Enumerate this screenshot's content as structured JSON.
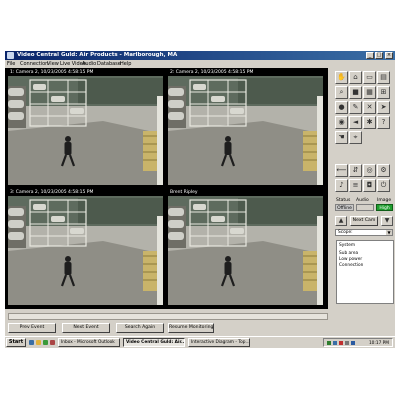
{
  "window": {
    "title": "Video Central Guld: Air Products - Marlborough, MA"
  },
  "menu": [
    "File",
    "Connection",
    "View",
    "Live Video",
    "Audio",
    "Database",
    "Help"
  ],
  "cameras": [
    {
      "label": "1: Camera 2, 10/23/2005 4:58:15 PM"
    },
    {
      "label": "2: Camera 2, 10/23/2005 4:58:15 PM"
    },
    {
      "label": "3: Camera 2, 10/23/2005 4:58:15 PM"
    },
    {
      "label": "Brent Ripley"
    }
  ],
  "status_panel": {
    "status_label": "Status",
    "audio_label": "Audio",
    "image_label": "Image",
    "status_value": "Offline",
    "image_value": "High",
    "next_cam": "Next Cam",
    "scope_label": "Scope:",
    "system": {
      "title": "System",
      "lines": [
        "Sub area",
        "Low power",
        "Connection"
      ]
    }
  },
  "buttons": {
    "prev": "Prev Event",
    "next": "Next Event",
    "search": "Search Again",
    "resume": "Resume Monitoring"
  },
  "taskbar": {
    "start": "Start",
    "tasks": [
      "Inbox - Microsoft Outlook",
      "Video Central Guld: Air...",
      "Interactive Diagram - Top..."
    ],
    "clock": "10:17 PM"
  },
  "colors": {
    "title_gradient_start": "#0a246a",
    "title_gradient_end": "#3a6ea5",
    "status_offline": "#c8c8c8",
    "image_high": "#1f9e2e"
  }
}
